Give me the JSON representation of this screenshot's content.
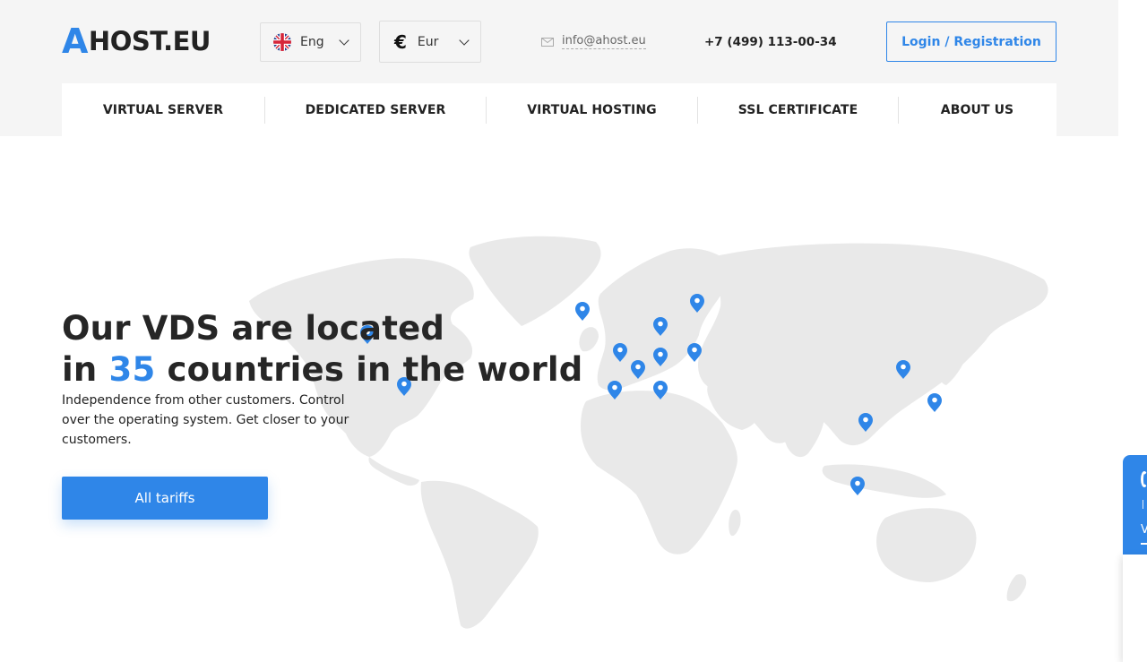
{
  "brand": {
    "logo_first": "A",
    "logo_rest": "HOST.EU"
  },
  "header": {
    "language": "Eng",
    "currency_symbol": "€",
    "currency": "Eur",
    "email": "info@ahost.eu",
    "phone": "+7 (499) 113-00-34",
    "login_label": "Login / Registration"
  },
  "nav": {
    "items": [
      {
        "label": "VIRTUAL SERVER"
      },
      {
        "label": "DEDICATED SERVER"
      },
      {
        "label": "VIRTUAL HOSTING"
      },
      {
        "label": "SSL CERTIFICATE"
      },
      {
        "label": "ABOUT US"
      }
    ]
  },
  "hero": {
    "title_line1": "Our VDS are located",
    "title_prefix": "in ",
    "title_number": "35",
    "title_suffix": " countries in the world",
    "description": "Independence from other customers. Control over the operating system. Get closer to your customers.",
    "button_label": "All tariffs"
  },
  "colors": {
    "accent": "#2f86e8",
    "map": "#e9e9e9",
    "header_bg": "#f5f5f5"
  },
  "side_widget": {
    "text": "V"
  }
}
